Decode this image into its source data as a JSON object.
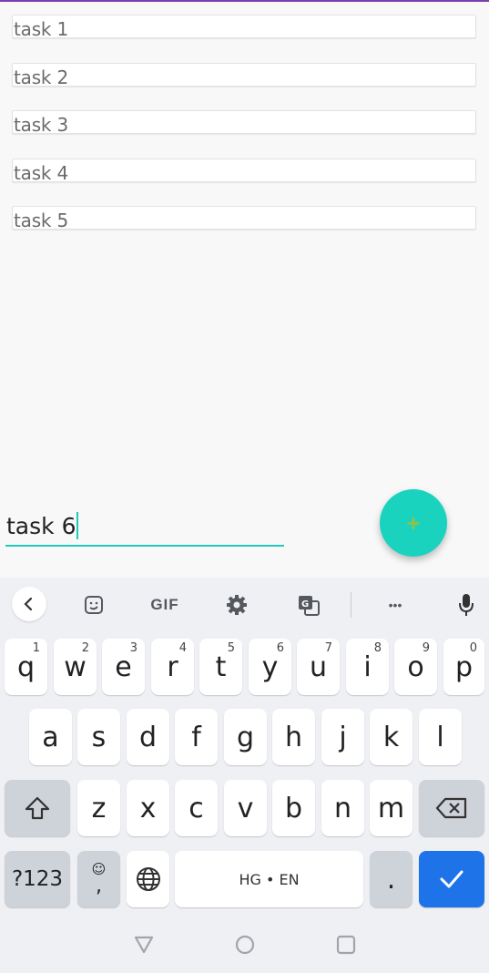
{
  "tasks": [
    "task 1",
    "task 2",
    "task 3",
    "task 4",
    "task 5"
  ],
  "new_task_input": {
    "value": "task 6"
  },
  "fab": {
    "label": "+",
    "color": "#1ad3bf"
  },
  "keyboard": {
    "toolbar": {
      "gif_label": "GIF",
      "more_label": "•••"
    },
    "row1": [
      {
        "key": "q",
        "hint": "1"
      },
      {
        "key": "w",
        "hint": "2"
      },
      {
        "key": "e",
        "hint": "3"
      },
      {
        "key": "r",
        "hint": "4"
      },
      {
        "key": "t",
        "hint": "5"
      },
      {
        "key": "y",
        "hint": "6"
      },
      {
        "key": "u",
        "hint": "7"
      },
      {
        "key": "i",
        "hint": "8"
      },
      {
        "key": "o",
        "hint": "9"
      },
      {
        "key": "p",
        "hint": "0"
      }
    ],
    "row2": [
      "a",
      "s",
      "d",
      "f",
      "g",
      "h",
      "j",
      "k",
      "l"
    ],
    "row3": [
      "z",
      "x",
      "c",
      "v",
      "b",
      "n",
      "m"
    ],
    "row4": {
      "symbols": "?123",
      "emoji_comma": ",",
      "space": "HG • EN",
      "period": "."
    },
    "accent": "#1e73e8"
  }
}
